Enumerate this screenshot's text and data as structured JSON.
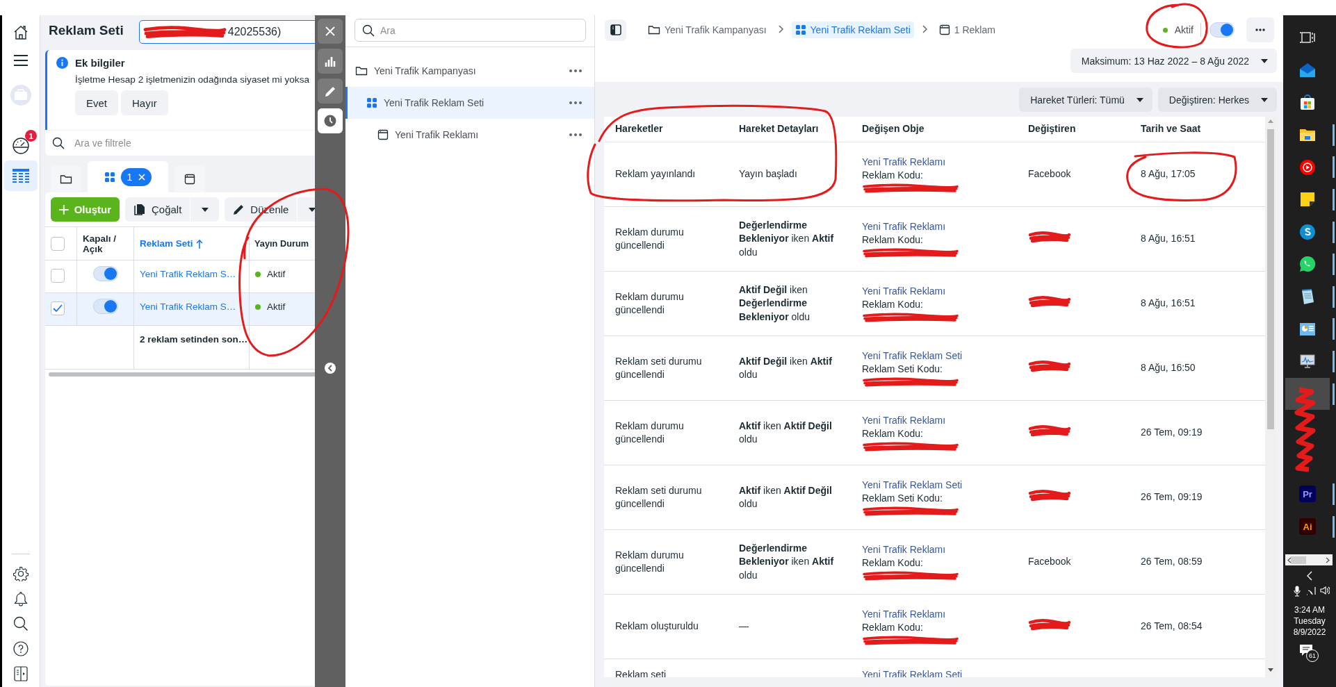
{
  "nav_rail": {
    "top_items": [
      {
        "kind": "home",
        "selected": false
      },
      {
        "kind": "menu",
        "selected": false
      },
      {
        "kind": "account",
        "selected": false
      },
      {
        "kind": "gauge",
        "selected": false,
        "badge": "1"
      },
      {
        "kind": "table",
        "selected": true
      }
    ],
    "bottom_items": [
      {
        "kind": "settings"
      },
      {
        "kind": "bell"
      },
      {
        "kind": "search"
      },
      {
        "kind": "help"
      },
      {
        "kind": "panel"
      }
    ]
  },
  "ad_set_panel": {
    "title": "Reklam Seti",
    "account_field": {
      "value": "42025536)"
    },
    "info": {
      "title": "Ek bilgiler",
      "text": "İşletme Hesap 2 işletmenizin odağında siyaset mi yoksa",
      "buttons": [
        "Evet",
        "Hayır"
      ]
    },
    "search": {
      "placeholder": "Ara ve filtrele"
    },
    "tabs": [
      {
        "kind": "campaign",
        "selected": false
      },
      {
        "kind": "ad_set",
        "selected": true,
        "chip": "1"
      },
      {
        "kind": "ad",
        "selected": false
      }
    ],
    "toolbar": {
      "create": "Oluştur",
      "duplicate": "Çoğalt",
      "edit": "Düzenle"
    },
    "table": {
      "select_all": {
        "checked": false
      },
      "columns": [
        "Kapalı / Açık",
        "Reklam Seti",
        "Yayın Durum"
      ],
      "rows": [
        {
          "selected": false,
          "on": true,
          "name": "Yeni Trafik Reklam S…",
          "status": "Aktif",
          "active": true
        },
        {
          "selected": true,
          "on": true,
          "name": "Yeni Trafik Reklam S…",
          "status": "Aktif",
          "active": true
        }
      ],
      "summary": "2 reklam setinden son…"
    }
  },
  "tool_strip": {
    "items": [
      {
        "kind": "close",
        "selected": false
      },
      {
        "kind": "chart",
        "selected": false
      },
      {
        "kind": "edit",
        "selected": false
      },
      {
        "kind": "history",
        "selected": true
      }
    ]
  },
  "tree": {
    "search": {
      "placeholder": "Ara"
    },
    "items": [
      {
        "kind": "campaign",
        "label": "Yeni Trafik Kampanyası",
        "selected": false,
        "children": [
          {
            "kind": "ad_set",
            "label": "Yeni Trafik Reklam Seti",
            "selected": true,
            "children": [
              {
                "kind": "ad",
                "label": "Yeni Trafik Reklamı",
                "selected": false
              }
            ]
          }
        ]
      }
    ]
  },
  "history_panel": {
    "breadcrumb": [
      {
        "kind": "campaign",
        "label": "Yeni Trafik Kampanyası",
        "selected": false
      },
      {
        "kind": "ad_set",
        "label": "Yeni Trafik Reklam Seti",
        "selected": true
      },
      {
        "kind": "ad",
        "label": "1 Reklam",
        "selected": false
      }
    ],
    "status": {
      "label": "Aktif",
      "active": true
    },
    "switch": {
      "on": true
    },
    "date_range": "Maksimum: 13 Haz 2022 – 8 Ağu 2022",
    "filters": [
      "Hareket Türleri: Tümü",
      "Değiştiren: Herkes"
    ],
    "table": {
      "columns": [
        "Hareketler",
        "Hareket Detayları",
        "Değişen Obje",
        "Değiştiren",
        "Tarih ve Saat"
      ],
      "rows": [
        {
          "action": "Reklam yayınlandı",
          "detail": "Yayın başladı",
          "object": "Yeni Trafik Reklamı",
          "code_label": "Reklam Kodu:",
          "changer": {
            "kind": "name",
            "text": "Facebook"
          },
          "time": "8 Ağu, 17:05"
        },
        {
          "action": "Reklam durumu güncellendi",
          "detail": "**Değerlendirme Bekleniyor** iken **Aktif** oldu",
          "object": "Yeni Trafik Reklamı",
          "code_label": "Reklam Kodu:",
          "changer": {
            "kind": "redacted"
          },
          "time": "8 Ağu, 16:51"
        },
        {
          "action": "Reklam durumu güncellendi",
          "detail": "**Aktif Değil** iken **Değerlendirme Bekleniyor** oldu",
          "object": "Yeni Trafik Reklamı",
          "code_label": "Reklam Kodu:",
          "changer": {
            "kind": "redacted"
          },
          "time": "8 Ağu, 16:51"
        },
        {
          "action": "Reklam seti durumu güncellendi",
          "detail": "**Aktif Değil** iken **Aktif** oldu",
          "object": "Yeni Trafik Reklam Seti",
          "code_label": "Reklam Seti Kodu:",
          "changer": {
            "kind": "redacted"
          },
          "time": "8 Ağu, 16:50"
        },
        {
          "action": "Reklam durumu güncellendi",
          "detail": "**Aktif** iken **Aktif Değil** oldu",
          "object": "Yeni Trafik Reklamı",
          "code_label": "Reklam Kodu:",
          "changer": {
            "kind": "redacted"
          },
          "time": "26 Tem, 09:19"
        },
        {
          "action": "Reklam seti durumu güncellendi",
          "detail": "**Aktif** iken **Aktif Değil** oldu",
          "object": "Yeni Trafik Reklam Seti",
          "code_label": "Reklam Seti Kodu:",
          "changer": {
            "kind": "redacted"
          },
          "time": "26 Tem, 09:19"
        },
        {
          "action": "Reklam durumu güncellendi",
          "detail": "**Değerlendirme Bekleniyor** iken **Aktif** oldu",
          "object": "Yeni Trafik Reklamı",
          "code_label": "Reklam Kodu:",
          "changer": {
            "kind": "name",
            "text": "Facebook"
          },
          "time": "26 Tem, 08:59"
        },
        {
          "action": "Reklam oluşturuldu",
          "detail": "—",
          "object": "Yeni Trafik Reklamı",
          "code_label": "Reklam Kodu:",
          "changer": {
            "kind": "redacted"
          },
          "time": "26 Tem, 08:54"
        },
        {
          "action": "Reklam seti",
          "object": "Yeni Trafik Reklam Seti"
        }
      ]
    }
  },
  "taskbar": {
    "apps": [
      {
        "kind": "task_view",
        "running": false,
        "selected": false
      },
      {
        "kind": "mail",
        "running": false,
        "selected": false
      },
      {
        "kind": "store",
        "running": false,
        "selected": false
      },
      {
        "kind": "explorer",
        "running": true,
        "selected": false
      },
      {
        "kind": "music",
        "running": true,
        "selected": false
      },
      {
        "kind": "sticky",
        "running": true,
        "selected": false
      },
      {
        "kind": "skype",
        "running": true,
        "selected": false
      },
      {
        "kind": "whatsapp",
        "running": true,
        "selected": false
      },
      {
        "kind": "notepad",
        "running": true,
        "selected": false
      },
      {
        "kind": "control",
        "running": true,
        "selected": false
      },
      {
        "kind": "monitor",
        "running": true,
        "selected": false
      },
      {
        "kind": "hidden",
        "running": true,
        "selected": true
      },
      {
        "kind": "premiere",
        "label": "Pr",
        "running": true,
        "selected": false
      },
      {
        "kind": "illustrator",
        "label": "Ai",
        "running": true,
        "selected": false
      }
    ],
    "clock": {
      "time": "3:24 AM",
      "day": "Tuesday",
      "date": "8/9/2022"
    },
    "notifications": "61"
  }
}
